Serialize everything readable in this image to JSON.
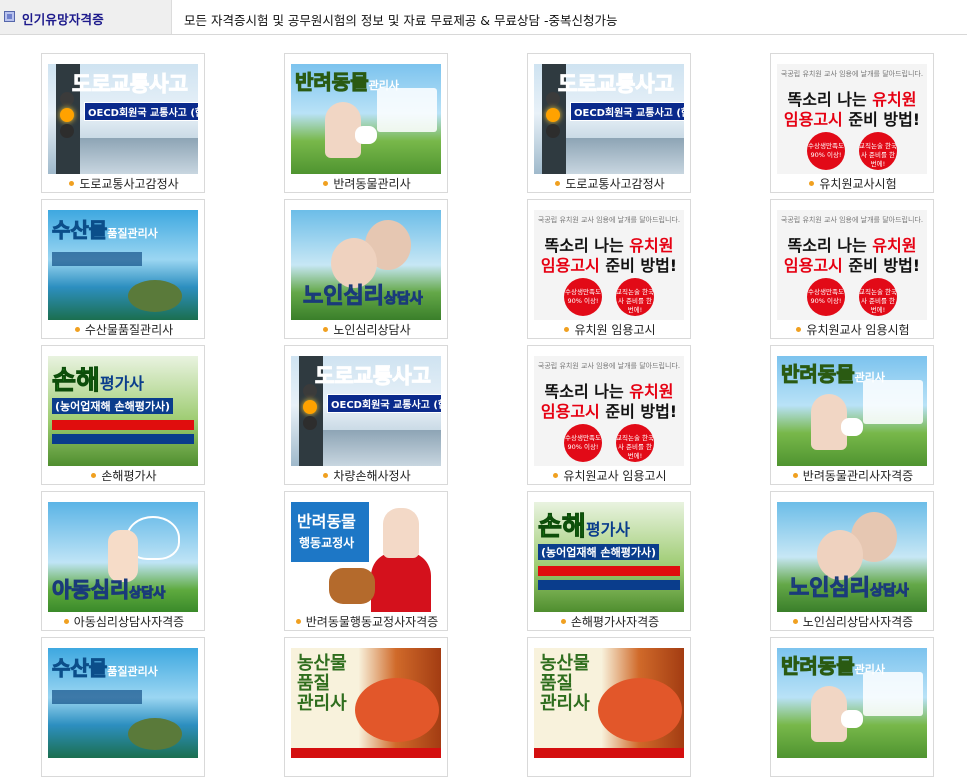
{
  "header": {
    "category_title": "인기유망자격증",
    "description": "모든 자격증시험 및 공무원시험의 정보 및 자료 무료제공 & 무료상담 -중복신청가능"
  },
  "items": [
    {
      "label": "도로교통사고감정사",
      "theme": "traffic"
    },
    {
      "label": "반려동물관리사",
      "theme": "pet"
    },
    {
      "label": "도로교통사고감정사",
      "theme": "traffic"
    },
    {
      "label": "유치원교사시험",
      "theme": "kinder"
    },
    {
      "label": "수산물품질관리사",
      "theme": "sea"
    },
    {
      "label": "노인심리상담사",
      "theme": "elder"
    },
    {
      "label": "유치원 임용고시",
      "theme": "kinder"
    },
    {
      "label": "유치원교사 임용시험",
      "theme": "kinder"
    },
    {
      "label": "손해평가사",
      "theme": "loss"
    },
    {
      "label": "차량손해사정사",
      "theme": "traffic"
    },
    {
      "label": "유치원교사 임용고시",
      "theme": "kinder"
    },
    {
      "label": "반려동물관리사자격증",
      "theme": "pet"
    },
    {
      "label": "아동심리상담사자격증",
      "theme": "child"
    },
    {
      "label": "반려동물행동교정사자격증",
      "theme": "petb"
    },
    {
      "label": "손해평가사자격증",
      "theme": "loss"
    },
    {
      "label": "노인심리상담사자격증",
      "theme": "elder"
    },
    {
      "label": "",
      "theme": "sea"
    },
    {
      "label": "",
      "theme": "agri"
    },
    {
      "label": "",
      "theme": "agri"
    },
    {
      "label": "",
      "theme": "pet"
    }
  ],
  "thumb_text": {
    "traffic": {
      "big": "도로교통사고",
      "sub": "OECD회원국 교통사고 (한국위)"
    },
    "pet": {
      "big": "반려동물",
      "small": "관리사"
    },
    "kinder": {
      "head": "국공립 유치원 교사 임용에 날개를 달아드립니다.",
      "l1a": "똑소리 나는 ",
      "l1b": "유치원",
      "l2a": "임용고시",
      "l2b": " 준비 방법!",
      "c1": "수상생만족도 90% 이상!",
      "c2": "교직논술 한국사 준비를 한 번에!"
    },
    "sea": {
      "big": "수산물",
      "small": "품질관리사"
    },
    "elder": {
      "big": "노인심리",
      "small": "상담사"
    },
    "loss": {
      "big": "손해",
      "small": "평가사",
      "sub": "(농어업재해 손해평가사)"
    },
    "child": {
      "big": "아동심리",
      "small": "상담사"
    },
    "petb": {
      "l1": "반려동물",
      "l2": "행동교정사"
    },
    "agri": {
      "l1": "농산물",
      "l2": "품질",
      "l3": "관리사"
    }
  },
  "colors": {
    "dot": "#f0a020",
    "title": "#1d1a8c",
    "header_tab_bg": "#efefef"
  }
}
